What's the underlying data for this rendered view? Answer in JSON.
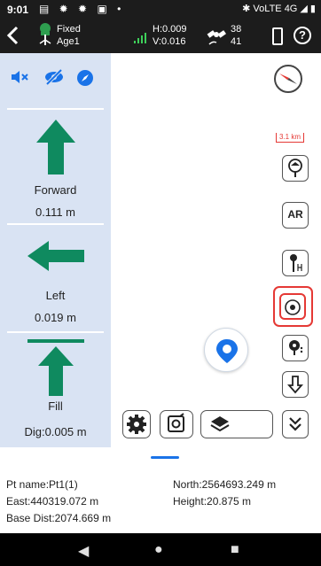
{
  "status_bar": {
    "time": "9:01",
    "left_icons": "▤ ✹ ✹ ▣ •",
    "right_text": "✱ VoLTE 4G ◢ ▮"
  },
  "top_bar": {
    "fix_status": "Fixed",
    "age": "Age1",
    "h_precision": "H:0.009",
    "v_precision": "V:0.016",
    "sat_used": "38",
    "sat_visible": "41",
    "help": "?"
  },
  "guidance": {
    "forward_label": "Forward",
    "forward_value": "0.111 m",
    "left_label": "Left",
    "left_value": "0.019 m",
    "fill_label": "Fill",
    "dig_value": "Dig:0.005 m"
  },
  "map": {
    "scale_label": "3.1 km",
    "ar_label": "AR"
  },
  "info": {
    "pt_name": "Pt name:Pt1(1)",
    "north": "North:2564693.249 m",
    "east": "East:440319.072 m",
    "height": "Height:20.875 m",
    "base_dist": "Base Dist:2074.669 m"
  },
  "colors": {
    "accent_blue": "#1a73e8",
    "arrow_green": "#0f8a5f",
    "highlight_red": "#e53935",
    "panel_bg": "#d9e3f3",
    "topbar_bg": "#1c1c1c"
  },
  "icons": {
    "mute": "mute-icon",
    "visibility_off": "eye-off-icon",
    "compass_small": "compass-icon",
    "back": "back-icon",
    "fix": "gnss-fix-icon",
    "satellite": "satellite-icon",
    "battery": "battery-icon",
    "help": "help-icon",
    "my_location": "my-location-icon",
    "settings": "gear-icon",
    "camera_settings": "camera-settings-icon",
    "layers": "layers-icon",
    "expand": "double-chevron-down-icon"
  }
}
